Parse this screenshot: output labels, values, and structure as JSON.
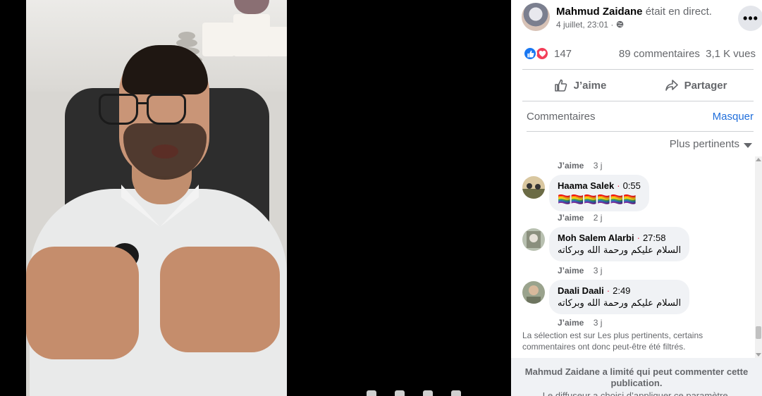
{
  "post": {
    "author": "Mahmud Zaidane",
    "status": "était en direct.",
    "date": "4 juillet, 23:01",
    "privacy_separator": "·",
    "privacy_icon": "globe-icon",
    "more_icon": "•••"
  },
  "reactions": {
    "count": "147",
    "types": [
      "like",
      "love"
    ],
    "comments": "89 commentaires",
    "views": "3,1 K vues"
  },
  "actions": {
    "like_label": "J’aime",
    "share_label": "Partager"
  },
  "comments_section": {
    "label": "Commentaires",
    "hide_label": "Masquer",
    "sort_label": "Plus pertinents",
    "like_label": "J’aime",
    "items": [
      {
        "name": "Haama Salek",
        "sep": "·",
        "time": "0:55",
        "text": "🏳️‍🌈🏳️‍🌈🏳️‍🌈🏳️‍🌈🏳️‍🌈🏳️‍🌈",
        "age": "2 j"
      },
      {
        "name": "Moh Salem Alarbi",
        "sep": "·",
        "time": "27:58",
        "text": "السلام عليكم ورحمة الله وبركاته",
        "age": "3 j"
      },
      {
        "name": "Daali Daali",
        "sep": "·",
        "time": "2:49",
        "text": "السلام عليكم ورحمة الله وبركاته",
        "age": "3 j"
      }
    ],
    "first_like_age": "3 j",
    "filter_note": "La sélection est sur Les plus pertinents, certains commentaires ont donc peut-être été filtrés."
  },
  "restriction": {
    "title": "Mahmud Zaidane a limité qui peut commenter cette publication.",
    "subtitle": "Le diffuseur a choisi d’appliquer ce paramètre."
  },
  "colors": {
    "accent": "#216fdb",
    "like": "#1877f2",
    "love": "#f33e58",
    "muted": "#65676b"
  }
}
